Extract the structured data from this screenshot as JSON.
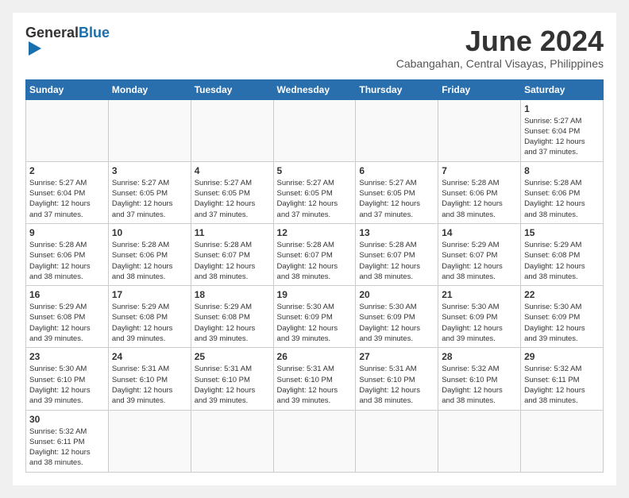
{
  "logo": {
    "text_general": "General",
    "text_blue": "Blue"
  },
  "header": {
    "month": "June 2024",
    "location": "Cabangahan, Central Visayas, Philippines"
  },
  "weekdays": [
    "Sunday",
    "Monday",
    "Tuesday",
    "Wednesday",
    "Thursday",
    "Friday",
    "Saturday"
  ],
  "weeks": [
    [
      {
        "day": "",
        "info": ""
      },
      {
        "day": "",
        "info": ""
      },
      {
        "day": "",
        "info": ""
      },
      {
        "day": "",
        "info": ""
      },
      {
        "day": "",
        "info": ""
      },
      {
        "day": "",
        "info": ""
      },
      {
        "day": "1",
        "info": "Sunrise: 5:27 AM\nSunset: 6:04 PM\nDaylight: 12 hours and 37 minutes."
      }
    ],
    [
      {
        "day": "2",
        "info": "Sunrise: 5:27 AM\nSunset: 6:04 PM\nDaylight: 12 hours and 37 minutes."
      },
      {
        "day": "3",
        "info": "Sunrise: 5:27 AM\nSunset: 6:05 PM\nDaylight: 12 hours and 37 minutes."
      },
      {
        "day": "4",
        "info": "Sunrise: 5:27 AM\nSunset: 6:05 PM\nDaylight: 12 hours and 37 minutes."
      },
      {
        "day": "5",
        "info": "Sunrise: 5:27 AM\nSunset: 6:05 PM\nDaylight: 12 hours and 37 minutes."
      },
      {
        "day": "6",
        "info": "Sunrise: 5:27 AM\nSunset: 6:05 PM\nDaylight: 12 hours and 37 minutes."
      },
      {
        "day": "7",
        "info": "Sunrise: 5:28 AM\nSunset: 6:06 PM\nDaylight: 12 hours and 38 minutes."
      },
      {
        "day": "8",
        "info": "Sunrise: 5:28 AM\nSunset: 6:06 PM\nDaylight: 12 hours and 38 minutes."
      }
    ],
    [
      {
        "day": "9",
        "info": "Sunrise: 5:28 AM\nSunset: 6:06 PM\nDaylight: 12 hours and 38 minutes."
      },
      {
        "day": "10",
        "info": "Sunrise: 5:28 AM\nSunset: 6:06 PM\nDaylight: 12 hours and 38 minutes."
      },
      {
        "day": "11",
        "info": "Sunrise: 5:28 AM\nSunset: 6:07 PM\nDaylight: 12 hours and 38 minutes."
      },
      {
        "day": "12",
        "info": "Sunrise: 5:28 AM\nSunset: 6:07 PM\nDaylight: 12 hours and 38 minutes."
      },
      {
        "day": "13",
        "info": "Sunrise: 5:28 AM\nSunset: 6:07 PM\nDaylight: 12 hours and 38 minutes."
      },
      {
        "day": "14",
        "info": "Sunrise: 5:29 AM\nSunset: 6:07 PM\nDaylight: 12 hours and 38 minutes."
      },
      {
        "day": "15",
        "info": "Sunrise: 5:29 AM\nSunset: 6:08 PM\nDaylight: 12 hours and 38 minutes."
      }
    ],
    [
      {
        "day": "16",
        "info": "Sunrise: 5:29 AM\nSunset: 6:08 PM\nDaylight: 12 hours and 39 minutes."
      },
      {
        "day": "17",
        "info": "Sunrise: 5:29 AM\nSunset: 6:08 PM\nDaylight: 12 hours and 39 minutes."
      },
      {
        "day": "18",
        "info": "Sunrise: 5:29 AM\nSunset: 6:08 PM\nDaylight: 12 hours and 39 minutes."
      },
      {
        "day": "19",
        "info": "Sunrise: 5:30 AM\nSunset: 6:09 PM\nDaylight: 12 hours and 39 minutes."
      },
      {
        "day": "20",
        "info": "Sunrise: 5:30 AM\nSunset: 6:09 PM\nDaylight: 12 hours and 39 minutes."
      },
      {
        "day": "21",
        "info": "Sunrise: 5:30 AM\nSunset: 6:09 PM\nDaylight: 12 hours and 39 minutes."
      },
      {
        "day": "22",
        "info": "Sunrise: 5:30 AM\nSunset: 6:09 PM\nDaylight: 12 hours and 39 minutes."
      }
    ],
    [
      {
        "day": "23",
        "info": "Sunrise: 5:30 AM\nSunset: 6:10 PM\nDaylight: 12 hours and 39 minutes."
      },
      {
        "day": "24",
        "info": "Sunrise: 5:31 AM\nSunset: 6:10 PM\nDaylight: 12 hours and 39 minutes."
      },
      {
        "day": "25",
        "info": "Sunrise: 5:31 AM\nSunset: 6:10 PM\nDaylight: 12 hours and 39 minutes."
      },
      {
        "day": "26",
        "info": "Sunrise: 5:31 AM\nSunset: 6:10 PM\nDaylight: 12 hours and 39 minutes."
      },
      {
        "day": "27",
        "info": "Sunrise: 5:31 AM\nSunset: 6:10 PM\nDaylight: 12 hours and 38 minutes."
      },
      {
        "day": "28",
        "info": "Sunrise: 5:32 AM\nSunset: 6:10 PM\nDaylight: 12 hours and 38 minutes."
      },
      {
        "day": "29",
        "info": "Sunrise: 5:32 AM\nSunset: 6:11 PM\nDaylight: 12 hours and 38 minutes."
      }
    ],
    [
      {
        "day": "30",
        "info": "Sunrise: 5:32 AM\nSunset: 6:11 PM\nDaylight: 12 hours and 38 minutes."
      },
      {
        "day": "",
        "info": ""
      },
      {
        "day": "",
        "info": ""
      },
      {
        "day": "",
        "info": ""
      },
      {
        "day": "",
        "info": ""
      },
      {
        "day": "",
        "info": ""
      },
      {
        "day": "",
        "info": ""
      }
    ]
  ]
}
